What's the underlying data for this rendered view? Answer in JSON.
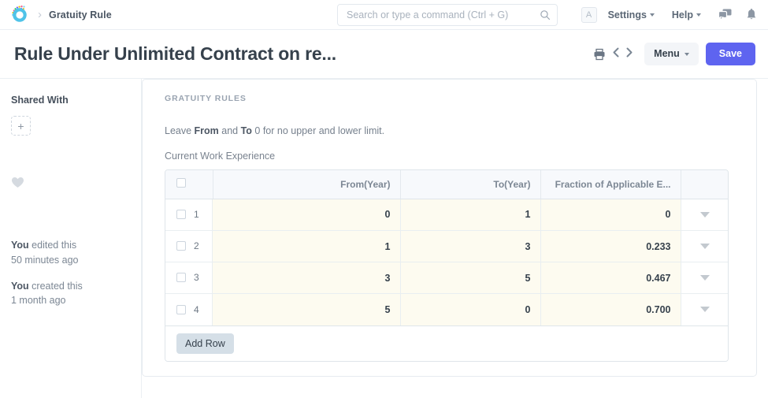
{
  "navbar": {
    "logo_name": "frappe-logo",
    "breadcrumb": "Gratuity Rule",
    "search": {
      "placeholder": "Search or type a command (Ctrl + G)",
      "value": "",
      "icon": "search-icon"
    },
    "avatar_initial": "A",
    "settings_label": "Settings",
    "help_label": "Help",
    "chat_icon": "chat-bubbles-icon",
    "bell_icon": "notification-bell-icon"
  },
  "titlebar": {
    "title": "Rule Under Unlimited Contract on re...",
    "print_icon": "printer-icon",
    "prev_icon": "chevron-left-icon",
    "next_icon": "chevron-right-icon",
    "menu_label": "Menu",
    "save_label": "Save",
    "save_color": "#5e64f0"
  },
  "sidebar": {
    "shared_with_label": "Shared With",
    "add_label": "+",
    "like_icon": "heart-icon",
    "activity": [
      {
        "who": "You",
        "action": " edited this",
        "time": "50 minutes ago"
      },
      {
        "who": "You",
        "action": " created this",
        "time": "1 month ago"
      }
    ]
  },
  "main": {
    "section_label": "GRATUITY RULES",
    "hint": {
      "pre": "Leave ",
      "b1": "From",
      "mid": " and ",
      "b2": "To",
      "post": " 0 for no upper and lower limit."
    },
    "field_label": "Current Work Experience",
    "table": {
      "columns": [
        "",
        "From(Year)",
        "To(Year)",
        "Fraction of Applicable E...",
        ""
      ],
      "rows": [
        {
          "num": "1",
          "from": "0",
          "to": "1",
          "fraction": "0"
        },
        {
          "num": "2",
          "from": "1",
          "to": "3",
          "fraction": "0.233"
        },
        {
          "num": "3",
          "from": "3",
          "to": "5",
          "fraction": "0.467"
        },
        {
          "num": "4",
          "from": "5",
          "to": "0",
          "fraction": "0.700"
        }
      ],
      "add_row_label": "Add Row",
      "row_dropdown_icon": "caret-down-icon",
      "row_checkbox": "row-checkbox"
    }
  }
}
